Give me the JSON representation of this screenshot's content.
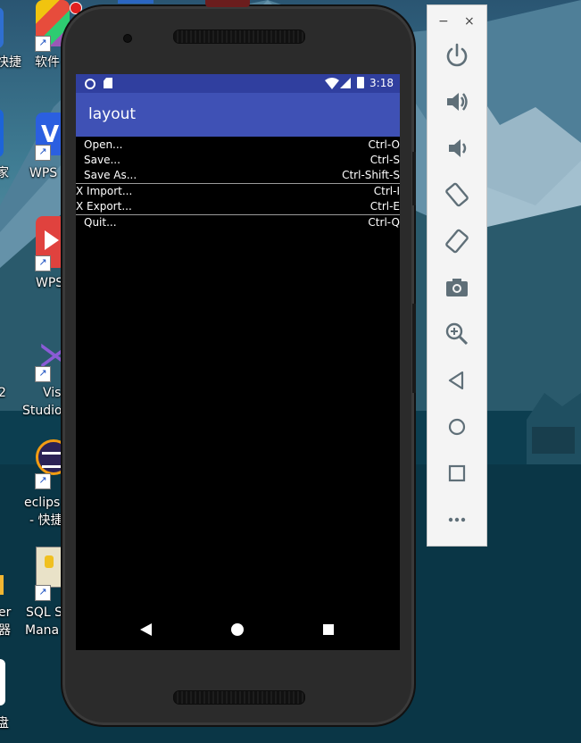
{
  "desktop": {
    "icons": [
      {
        "label1": "快捷",
        "label2": ""
      },
      {
        "label1": "软件",
        "label2": ""
      },
      {
        "label1": "WPS",
        "label2": ""
      },
      {
        "label1": "家",
        "label2": ""
      },
      {
        "label1": "WPS",
        "label2": ""
      },
      {
        "label1": "Vis",
        "label2": "Studio"
      },
      {
        "label1": "eclips",
        "label2": "- 快捷"
      },
      {
        "label1": "SQL S",
        "label2": "Mana"
      },
      {
        "label1": "er",
        "label2": "器"
      },
      {
        "label1": "盘",
        "label2": ""
      }
    ]
  },
  "device": {
    "status_time": "3:18",
    "app_title": "layout",
    "menu": [
      {
        "label": "Open...",
        "shortcut": "Ctrl-O"
      },
      {
        "label": "Save...",
        "shortcut": "Ctrl-S"
      },
      {
        "label": "Save As...",
        "shortcut": "Ctrl-Shift-S"
      },
      {
        "label": "X Import...",
        "shortcut": "Ctrl-I"
      },
      {
        "label": "X Export...",
        "shortcut": "Ctrl-E"
      },
      {
        "label": "Quit...",
        "shortcut": "Ctrl-Q"
      }
    ]
  },
  "emulator_toolbar": {
    "minimize_glyph": "−",
    "close_glyph": "×",
    "buttons": [
      "power-icon",
      "volume-up-icon",
      "volume-down-icon",
      "rotate-left-icon",
      "rotate-right-icon",
      "camera-icon",
      "zoom-icon",
      "back-icon",
      "home-icon",
      "overview-icon",
      "more-icon"
    ]
  },
  "colors": {
    "status_bar": "#303f9f",
    "app_bar": "#3f51b5",
    "screen_bg": "#000000"
  }
}
